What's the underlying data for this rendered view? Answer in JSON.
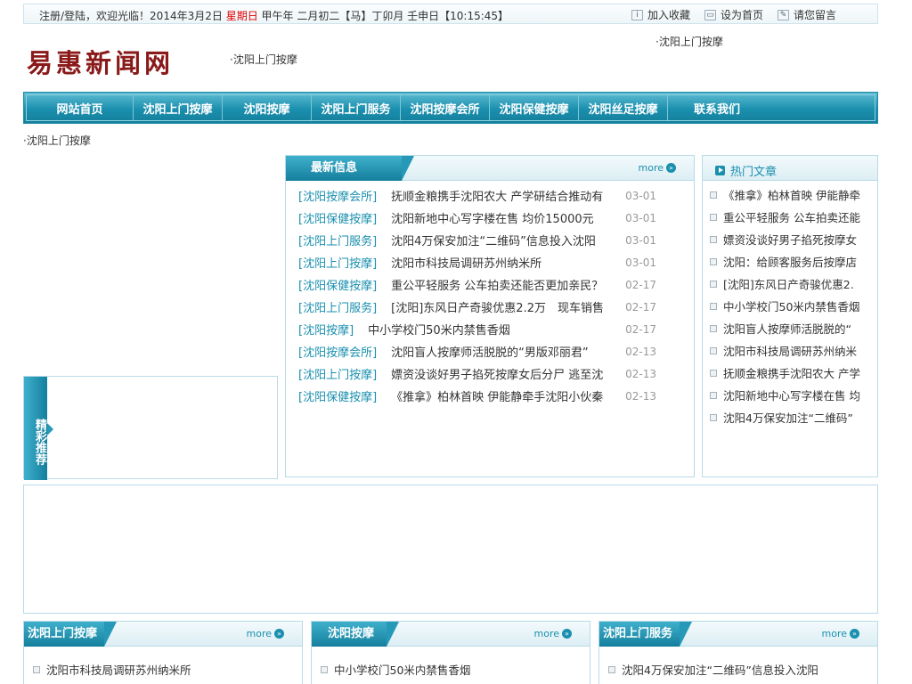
{
  "topbar": {
    "greeting": "注册/登陆，欢迎光临！2014年3月2日",
    "weekday": "星期日",
    "lunar": "甲午年 二月初二【马】丁卯月 壬申日【10:15:45】",
    "links": [
      {
        "label": "加入收藏",
        "icon": "info-icon"
      },
      {
        "label": "设为首页",
        "icon": "monitor-icon"
      },
      {
        "label": "请您留言",
        "icon": "message-icon"
      }
    ]
  },
  "header": {
    "logo": "易惠新闻网",
    "link_left": "·沈阳上门按摩",
    "link_right": "·沈阳上门按摩"
  },
  "nav": [
    "网站首页",
    "沈阳上门按摩",
    "沈阳按摩",
    "沈阳上门服务",
    "沈阳按摩会所",
    "沈阳保健按摩",
    "沈阳丝足按摩",
    "联系我们"
  ],
  "sub_link": "·沈阳上门按摩",
  "latest": {
    "title": "最新信息",
    "more": "more",
    "items": [
      {
        "cat": "[沈阳按摩会所]",
        "title": "抚顺金粮携手沈阳农大 产学研结合推动有",
        "date": "03-01"
      },
      {
        "cat": "[沈阳保健按摩]",
        "title": "沈阳新地中心写字楼在售 均价15000元",
        "date": "03-01"
      },
      {
        "cat": "[沈阳上门服务]",
        "title": "沈阳4万保安加注“二维码”信息投入沈阳",
        "date": "03-01"
      },
      {
        "cat": "[沈阳上门按摩]",
        "title": "沈阳市科技局调研苏州纳米所",
        "date": "03-01"
      },
      {
        "cat": "[沈阳保健按摩]",
        "title": "重公平轻服务 公车拍卖还能否更加亲民？",
        "date": "02-17"
      },
      {
        "cat": "[沈阳上门服务]",
        "title": "[沈阳]东风日产奇骏优惠2.2万　现车销售",
        "date": "02-17"
      },
      {
        "cat": "[沈阳按摩]",
        "title": "中小学校门50米内禁售香烟",
        "date": "02-17"
      },
      {
        "cat": "[沈阳按摩会所]",
        "title": "沈阳盲人按摩师活脱脱的“男版邓丽君”",
        "date": "02-13"
      },
      {
        "cat": "[沈阳上门按摩]",
        "title": "嫖资没谈好男子掐死按摩女后分尸 逃至沈",
        "date": "02-13"
      },
      {
        "cat": "[沈阳保健按摩]",
        "title": "《推拿》柏林首映 伊能静牵手沈阳小伙秦",
        "date": "02-13"
      }
    ]
  },
  "hot": {
    "title": "热门文章",
    "items": [
      "《推拿》柏林首映 伊能静牵",
      "重公平轻服务 公车拍卖还能",
      "嫖资没谈好男子掐死按摩女",
      "沈阳：给顾客服务后按摩店",
      "[沈阳]东风日产奇骏优惠2.",
      "中小学校门50米内禁售香烟",
      "沈阳盲人按摩师活脱脱的“",
      "沈阳市科技局调研苏州纳米",
      "抚顺金粮携手沈阳农大 产学",
      "沈阳新地中心写字楼在售 均",
      "沈阳4万保安加注“二维码”"
    ]
  },
  "recommend": {
    "title": "精彩推荐"
  },
  "sections": [
    {
      "title": "沈阳上门按摩",
      "more": "more",
      "first": "沈阳市科技局调研苏州纳米所"
    },
    {
      "title": "沈阳按摩",
      "more": "more",
      "first": "中小学校门50米内禁售香烟"
    },
    {
      "title": "沈阳上门服务",
      "more": "more",
      "first": "沈阳4万保安加注“二维码”信息投入沈阳"
    }
  ]
}
